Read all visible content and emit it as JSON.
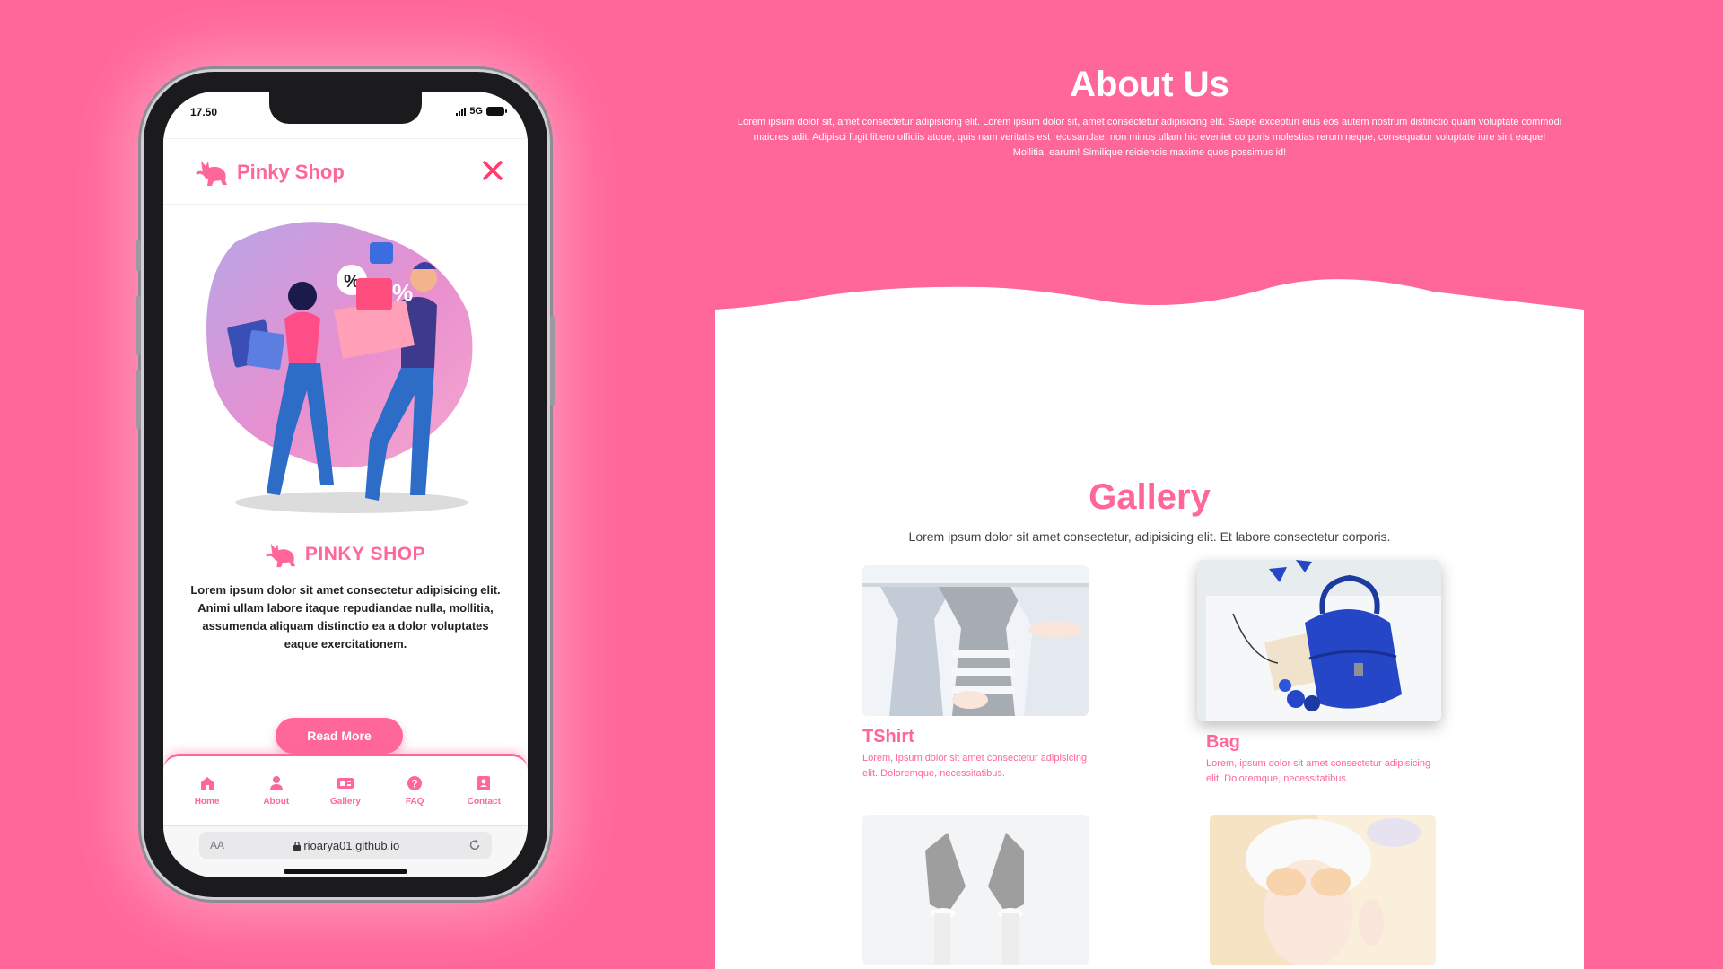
{
  "phone": {
    "status_time": "17.50",
    "network": "5G",
    "brand": "Pinky Shop",
    "caption_brand": "PINKY SHOP",
    "caption_text": "Lorem ipsum dolor sit amet consectetur adipisicing elit. Animi ullam labore itaque repudiandae nulla, mollitia, assumenda aliquam distinctio ea a dolor voluptates eaque exercitationem.",
    "read_more": "Read More",
    "nav": [
      {
        "label": "Home",
        "icon": "home-icon"
      },
      {
        "label": "About",
        "icon": "user-icon"
      },
      {
        "label": "Gallery",
        "icon": "gallery-icon"
      },
      {
        "label": "FAQ",
        "icon": "question-icon"
      },
      {
        "label": "Contact",
        "icon": "contact-icon"
      }
    ],
    "url_aa": "AA",
    "url": "rioarya01.github.io"
  },
  "site": {
    "about_title": "About Us",
    "about_text": "Lorem ipsum dolor sit, amet consectetur adipisicing elit. Lorem ipsum dolor sit, amet consectetur adipisicing elit. Saepe excepturi eius eos autem nostrum distinctio quam voluptate commodi maiores adit. Adipisci fugit libero officiis atque, quis nam veritatis est recusandae, non minus ullam hic eveniet corporis molestias rerum neque, consequatur voluptate iure sint eaque! Mollitia, earum! Similique reiciendis maxime quos possimus id!",
    "gallery_title": "Gallery",
    "gallery_sub": "Lorem ipsum dolor sit amet consectetur, adipisicing elit. Et labore consectetur corporis.",
    "cards": [
      {
        "title": "TShirt",
        "text": "Lorem, ipsum dolor sit amet consectetur adipisicing elit. Doloremque, necessitatibus."
      },
      {
        "title": "Bag",
        "text": "Lorem, ipsum dolor sit amet consectetur adipisicing elit. Doloremque, necessitatibus."
      }
    ]
  },
  "colors": {
    "brand_pink": "#ff6699",
    "white": "#ffffff"
  }
}
